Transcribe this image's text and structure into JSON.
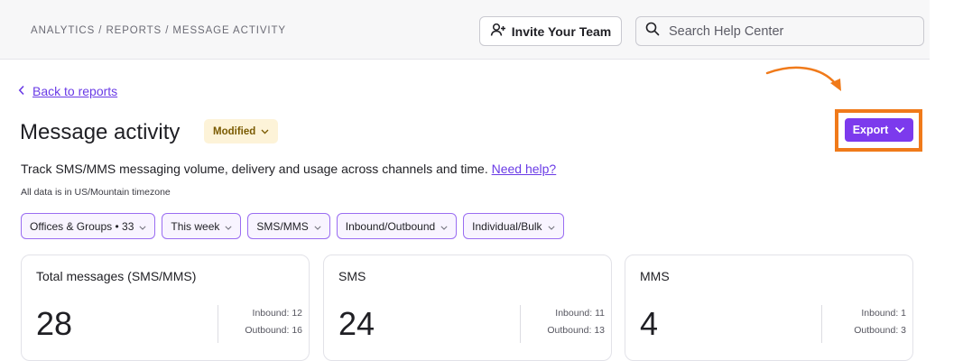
{
  "header": {
    "breadcrumb": "ANALYTICS / REPORTS / MESSAGE ACTIVITY",
    "invite_label": "Invite Your Team",
    "search_placeholder": "Search Help Center"
  },
  "page": {
    "back_label": "Back to reports",
    "title": "Message activity",
    "badge": "Modified",
    "export_label": "Export",
    "description": "Track SMS/MMS messaging volume, delivery and usage across channels and time.",
    "help_link": "Need help?",
    "timezone_note": "All data is in US/Mountain timezone"
  },
  "filters": [
    {
      "label": "Offices & Groups • 33"
    },
    {
      "label": "This week"
    },
    {
      "label": "SMS/MMS"
    },
    {
      "label": "Inbound/Outbound"
    },
    {
      "label": "Individual/Bulk"
    }
  ],
  "cards": [
    {
      "title": "Total messages (SMS/MMS)",
      "value": "28",
      "inbound": "Inbound: 12",
      "outbound": "Outbound: 16"
    },
    {
      "title": "SMS",
      "value": "24",
      "inbound": "Inbound: 11",
      "outbound": "Outbound: 13"
    },
    {
      "title": "MMS",
      "value": "4",
      "inbound": "Inbound: 1",
      "outbound": "Outbound: 3"
    }
  ],
  "colors": {
    "accent": "#7c3aed",
    "highlight": "#f07a1a",
    "badge_bg": "#fdf3d8"
  },
  "icons": [
    "user-plus-icon",
    "search-icon",
    "chevron-left-icon",
    "chevron-down-icon",
    "arrow-annotation-icon"
  ]
}
